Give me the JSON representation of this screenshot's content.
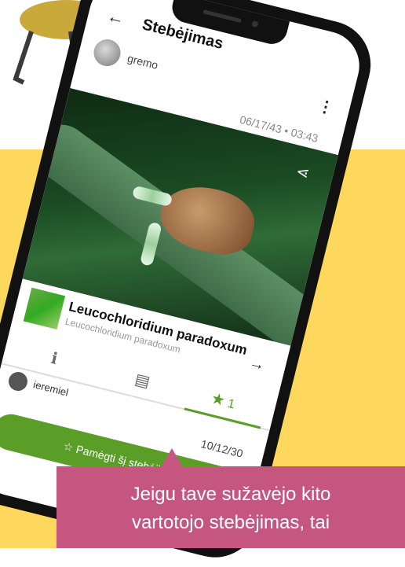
{
  "app": {
    "title": "Stebėjimas",
    "user": "gremo",
    "observed_at": "06/17/43 • 03:43"
  },
  "species": {
    "name": "Leucochloridium paradoxum",
    "latin": "Leucochloridium paradoxum"
  },
  "tabs": {
    "fav_count": "1"
  },
  "favorites": {
    "user": "ieremiel",
    "date": "10/12/30"
  },
  "actions": {
    "like_button": "Pamėgti šį stebėjimą"
  },
  "caption": {
    "line1": "Jeigu tave sužavėjo kito",
    "line2": "vartotojo stebėjimas, tai"
  }
}
